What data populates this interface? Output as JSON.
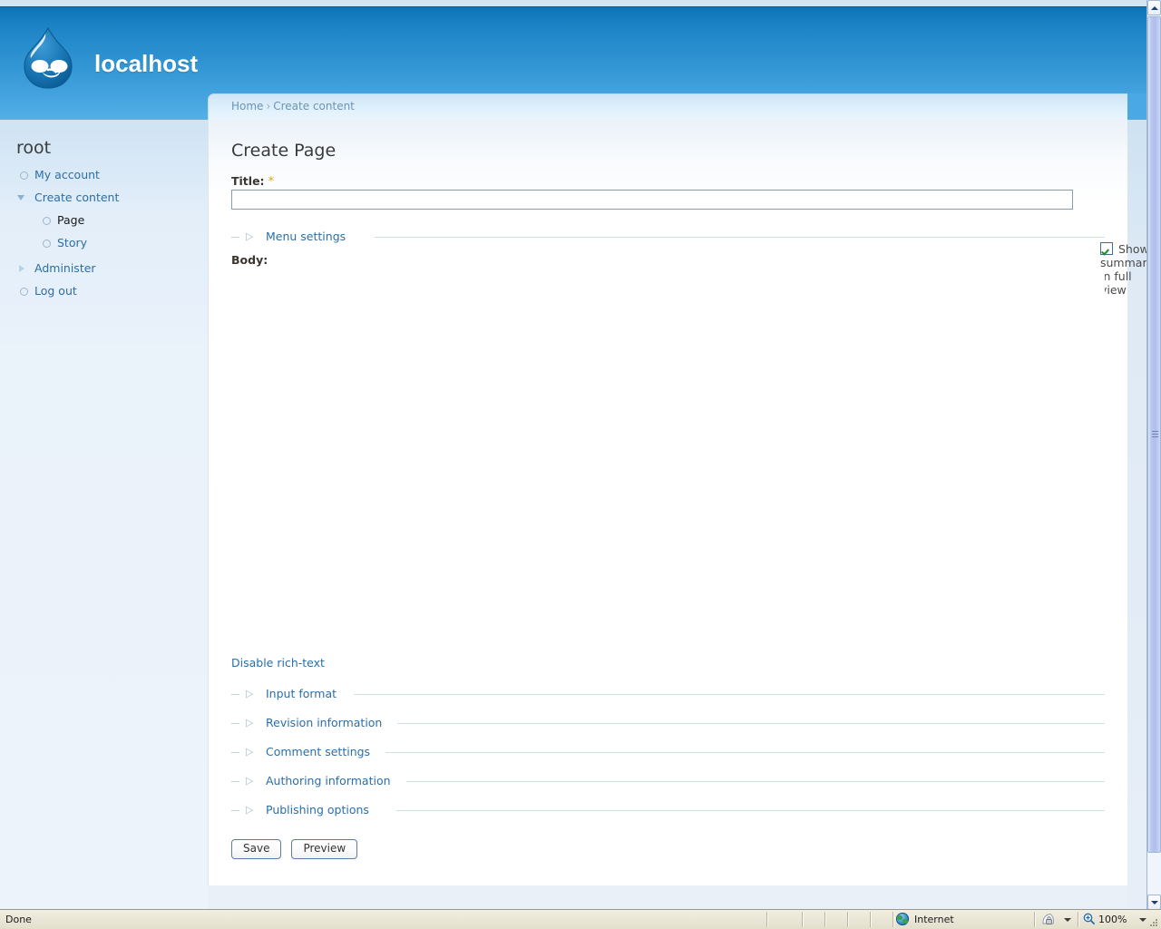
{
  "browser": {
    "status_text": "Done",
    "zone_label": "Internet",
    "zone_icon": "globe-icon",
    "protected_mode_icon": "security-lock-icon",
    "zoom_level": "100%",
    "zoom_icon": "magnifier-plus-icon",
    "scrollbar": {
      "up_icon": "chevron-up-icon",
      "down_icon": "chevron-down-icon",
      "grip_icon": "scrollbar-grip-icon"
    }
  },
  "header": {
    "site_name": "localhost",
    "logo_icon": "drupal-drop-logo",
    "gradient_top": "#0d74b8",
    "gradient_bottom": "#55b0e6"
  },
  "breadcrumb": {
    "items": [
      {
        "label": "Home"
      },
      {
        "label": "Create content"
      }
    ],
    "separator": "›"
  },
  "sidebar": {
    "title": "root",
    "items": [
      {
        "label": "My account",
        "level": 1,
        "marker": "bullet-icon",
        "active": false
      },
      {
        "label": "Create content",
        "level": 1,
        "marker": "triangle-down-icon",
        "active": false
      },
      {
        "label": "Page",
        "level": 2,
        "marker": "bullet-icon",
        "active": true
      },
      {
        "label": "Story",
        "level": 2,
        "marker": "bullet-icon",
        "active": false
      },
      {
        "label": "Administer",
        "level": 1,
        "marker": "triangle-right-icon",
        "active": false
      },
      {
        "label": "Log out",
        "level": 1,
        "marker": "bullet-icon",
        "active": false
      }
    ]
  },
  "main": {
    "page_title": "Create Page",
    "title_field": {
      "label": "Title:",
      "required_marker": "*",
      "value": "",
      "placeholder": ""
    },
    "menu_settings_fieldset": {
      "label": "Menu settings",
      "collapsed": true,
      "marker": "triangle-right-icon"
    },
    "summary_checkbox": {
      "label": "Show summary in full view",
      "checked": true,
      "icon": "checkbox-checked-icon"
    },
    "body_field": {
      "label": "Body:",
      "value": ""
    },
    "disable_richtext_link": "Disable rich-text",
    "fieldsets": [
      {
        "label": "Input format",
        "collapsed": true,
        "marker": "triangle-right-icon"
      },
      {
        "label": "Revision information",
        "collapsed": true,
        "marker": "triangle-right-icon"
      },
      {
        "label": "Comment settings",
        "collapsed": true,
        "marker": "triangle-right-icon"
      },
      {
        "label": "Authoring information",
        "collapsed": true,
        "marker": "triangle-right-icon"
      },
      {
        "label": "Publishing options",
        "collapsed": true,
        "marker": "triangle-right-icon"
      }
    ],
    "buttons": {
      "save": "Save",
      "preview": "Preview"
    }
  },
  "colors": {
    "link": "#2a6fa8",
    "required_star": "#e8a317",
    "checkbox_check": "#1f8a2a",
    "sidebar_bg": "#eaf2fa",
    "statusbar_bg": "#eae7d7"
  }
}
